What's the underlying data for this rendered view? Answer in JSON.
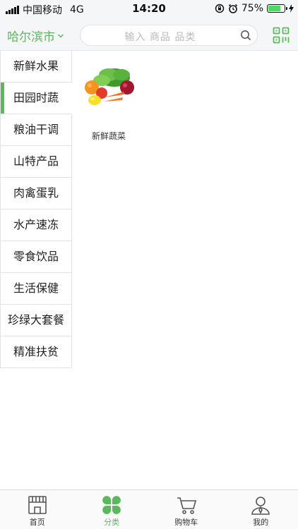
{
  "status": {
    "carrier": "中国移动",
    "network": "4G",
    "time": "14:20",
    "battery_percent": "75%",
    "battery_level": 0.75
  },
  "header": {
    "city": "哈尔滨市",
    "search_placeholder": "输入 商品 品类"
  },
  "sidebar": {
    "items": [
      {
        "label": "新鲜水果"
      },
      {
        "label": "田园时蔬"
      },
      {
        "label": "粮油干调"
      },
      {
        "label": "山特产品"
      },
      {
        "label": "肉禽蛋乳"
      },
      {
        "label": "水产速冻"
      },
      {
        "label": "零食饮品"
      },
      {
        "label": "生活保健"
      },
      {
        "label": "珍绿大套餐"
      },
      {
        "label": "精准扶贫"
      }
    ],
    "active_index": 1
  },
  "content": {
    "categories": [
      {
        "label": "新鲜蔬菜",
        "icon": "vegetables-image"
      }
    ]
  },
  "tabbar": {
    "items": [
      {
        "label": "首页",
        "icon": "storefront-icon"
      },
      {
        "label": "分类",
        "icon": "clover-icon"
      },
      {
        "label": "购物车",
        "icon": "cart-icon"
      },
      {
        "label": "我的",
        "icon": "user-icon"
      }
    ],
    "active_index": 1
  },
  "colors": {
    "accent": "#5cb85c",
    "background": "#f4f6f8"
  }
}
